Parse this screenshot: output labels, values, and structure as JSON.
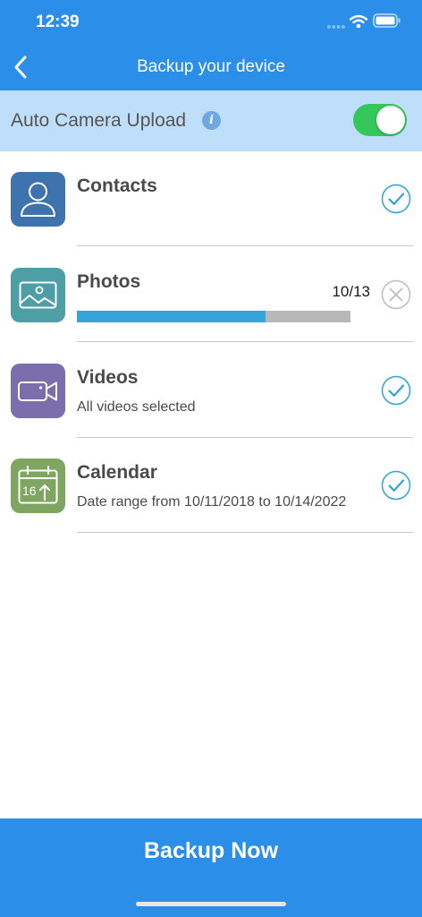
{
  "status_bar": {
    "time": "12:39"
  },
  "header": {
    "title": "Backup your device"
  },
  "auto_upload": {
    "label": "Auto Camera Upload",
    "enabled": true
  },
  "items": [
    {
      "title": "Contacts",
      "subtitle": "",
      "status": "selected",
      "icon": "contacts-icon",
      "icon_color": "#3f73ad"
    },
    {
      "title": "Photos",
      "progress_label": "10/13",
      "progress": 0.69,
      "status": "in-progress",
      "icon": "photos-icon",
      "icon_color": "#4e9ea6"
    },
    {
      "title": "Videos",
      "subtitle": "All videos selected",
      "status": "selected",
      "icon": "video-camera-icon",
      "icon_color": "#7a6ead"
    },
    {
      "title": "Calendar",
      "subtitle": "Date range from 10/11/2018 to 10/14/2022",
      "status": "selected",
      "icon": "calendar-icon",
      "calendar_day": "16",
      "icon_color": "#7fa660"
    }
  ],
  "footer": {
    "button_label": "Backup Now"
  },
  "colors": {
    "primary": "#2b8fea",
    "banner": "#bfdef9",
    "toggle_on": "#35c759",
    "check": "#2fa3d6",
    "progress_fill": "#35a4d8",
    "progress_track": "#b8b8b8"
  }
}
